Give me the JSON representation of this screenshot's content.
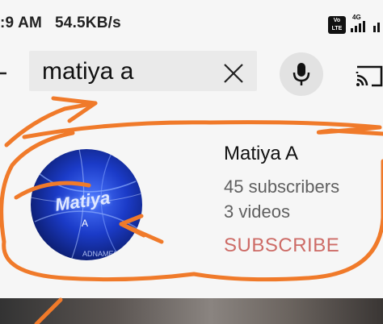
{
  "status_bar": {
    "time": ":9 AM",
    "speed": "54.5KB/s",
    "volte_top": "Vo",
    "volte_bottom": "LTE",
    "network": "4G"
  },
  "search": {
    "query": "matiya a"
  },
  "channel": {
    "name": "Matiya A",
    "subscribers": "45 subscribers",
    "videos": "3 videos",
    "subscribe_label": "SUBSCRIBE",
    "avatar_text": "Matiya",
    "avatar_subtext": "A",
    "avatar_watermark": "ADNAMES.NET"
  },
  "colors": {
    "subscribe": "#cd6b66",
    "annotation": "#f07a2a"
  }
}
